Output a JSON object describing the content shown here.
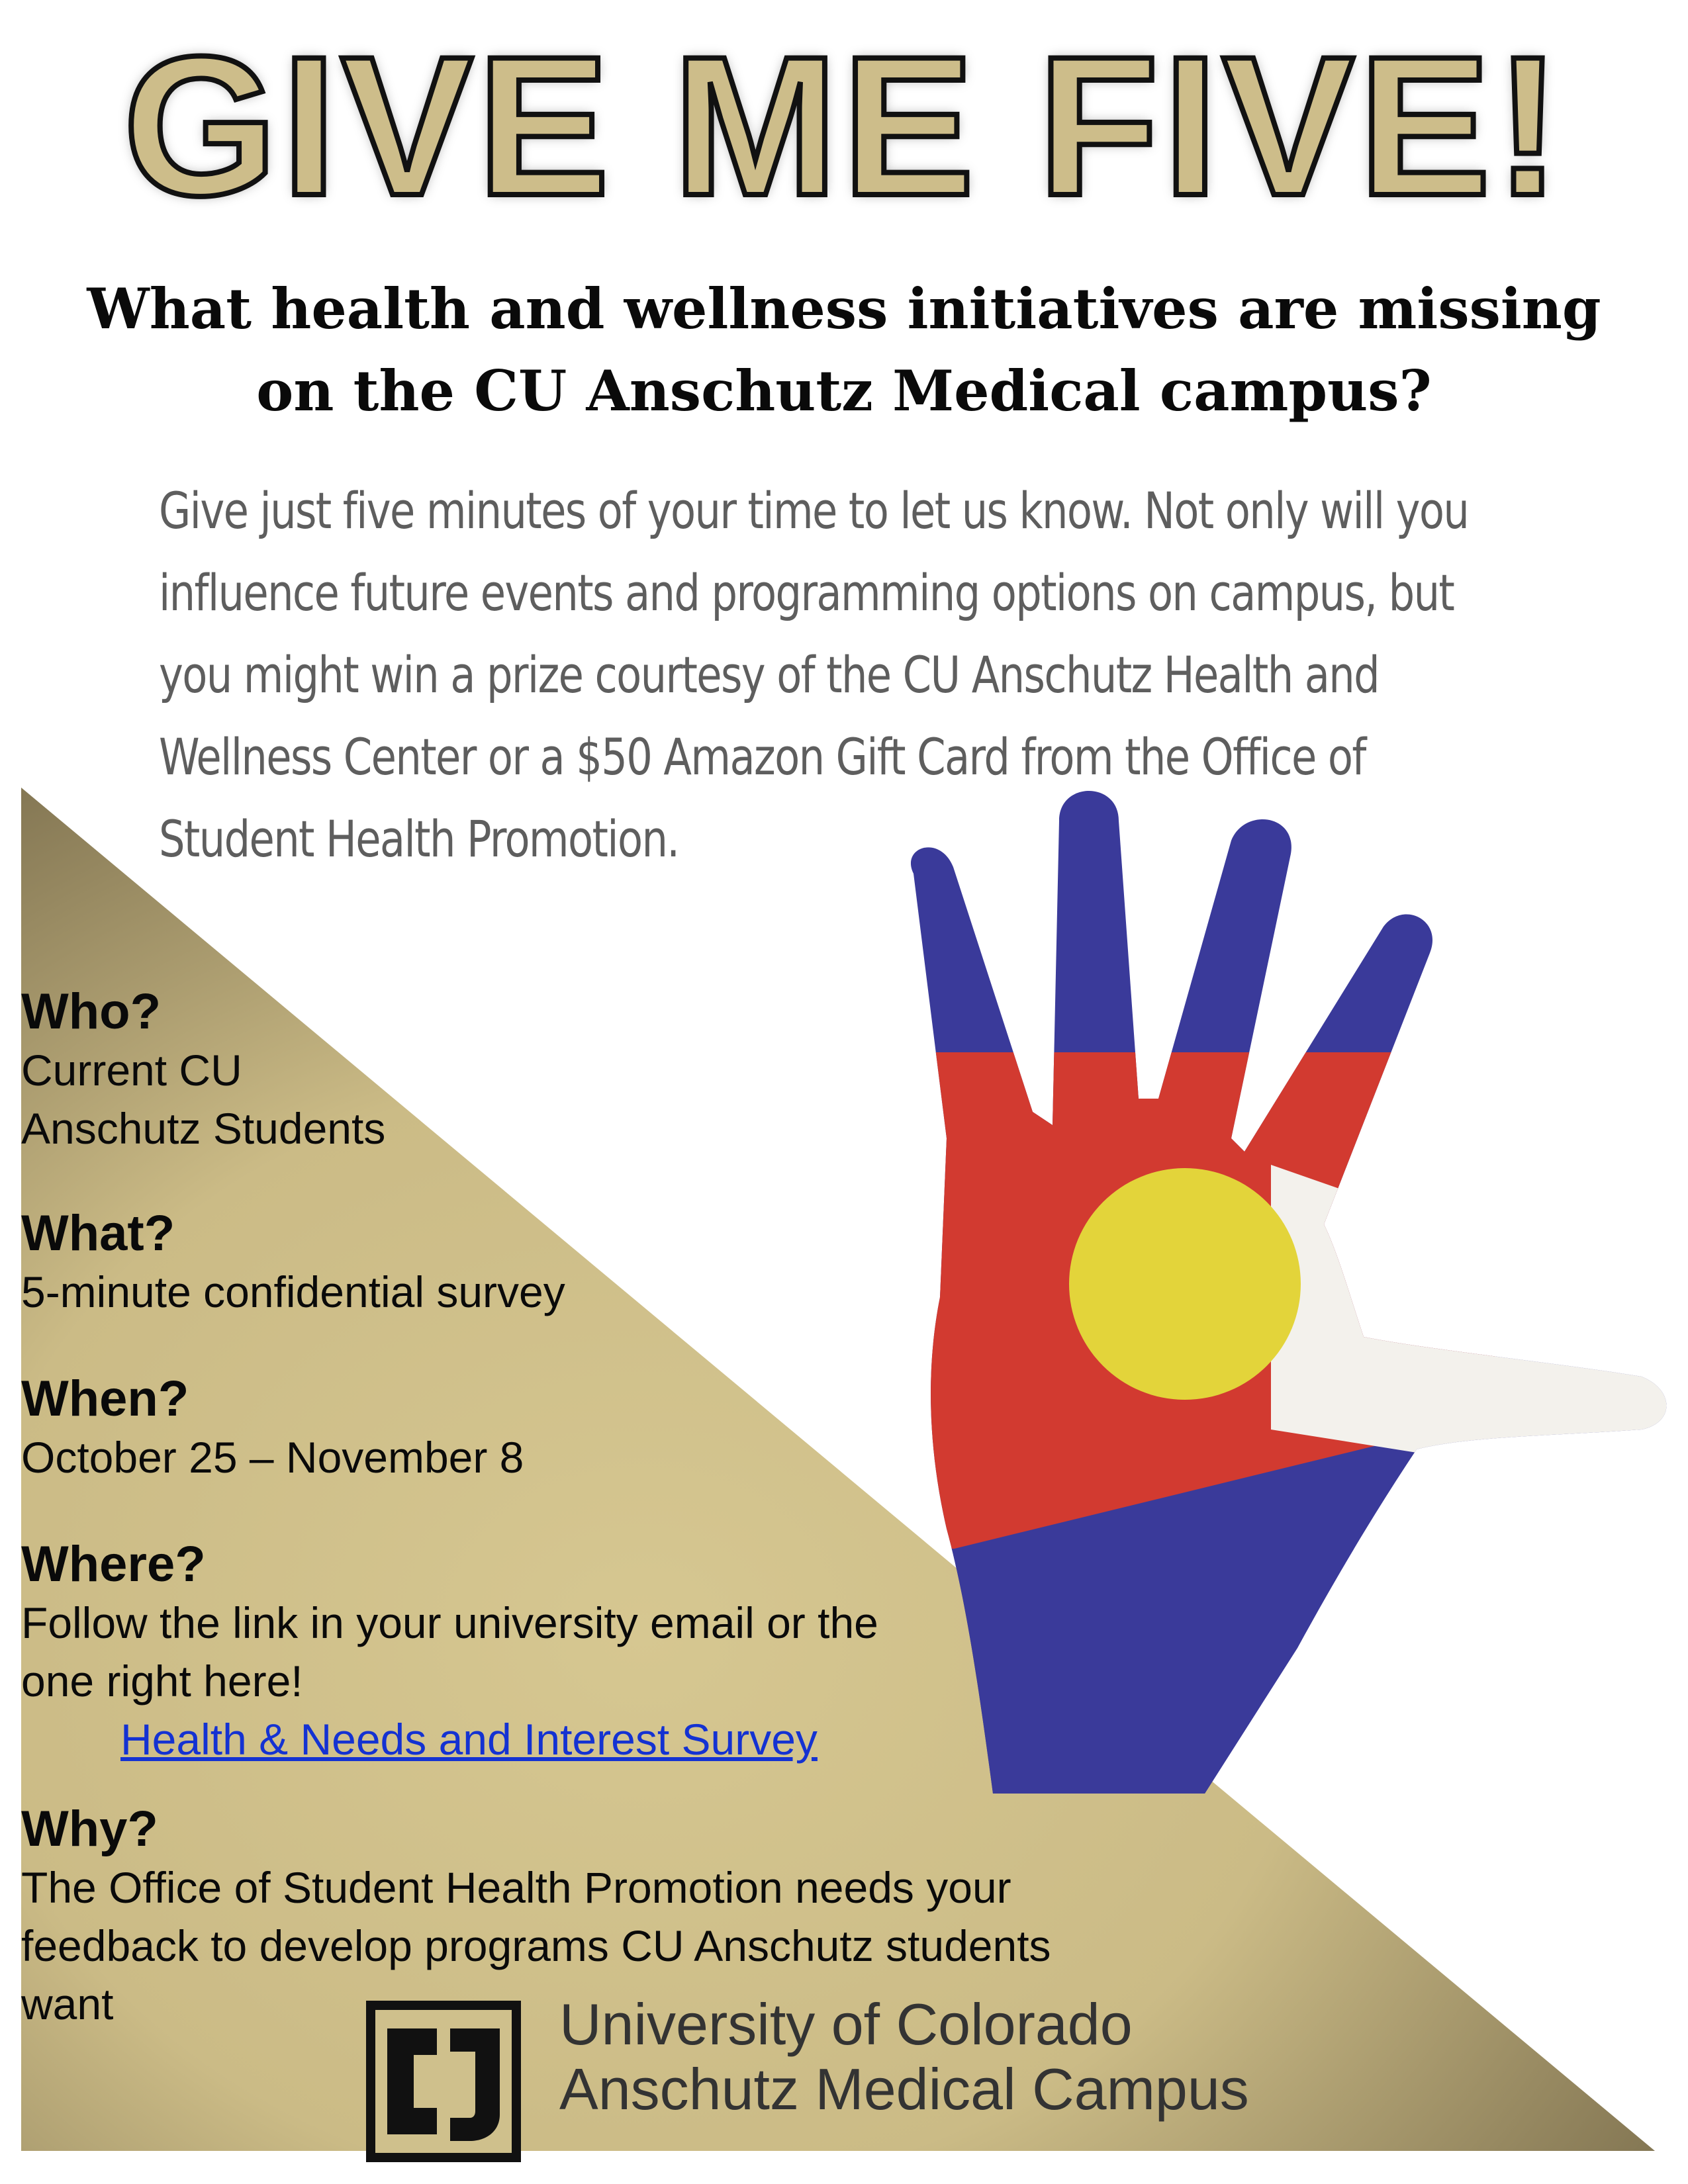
{
  "colors": {
    "gold": "#cfc08c",
    "gold_dark": "#8a7c55",
    "flag_blue": "#3a3a9a",
    "flag_red": "#d23a30",
    "flag_yellow": "#e3d43a",
    "link": "#1432d2"
  },
  "header": {
    "title": "GIVE ME FIVE!",
    "question_line1": "What health and wellness initiatives are missing",
    "question_line2": "on the CU Anschutz Medical campus?"
  },
  "intro": {
    "lines": [
      "Give just five minutes of your time to let us know. Not only will you",
      "influence future events and programming options on campus, but",
      "you might win a prize courtesy of the CU Anschutz Health and",
      "Wellness Center or a $50 Amazon Gift Card from the Office of",
      "Student Health Promotion."
    ]
  },
  "hand_image": {
    "icon": "colorado-flag-painted-hand-icon"
  },
  "who": {
    "heading": "Who?",
    "line1": "Current CU",
    "line2": "Anschutz Students"
  },
  "what": {
    "heading": "What?",
    "text": "5-minute confidential survey"
  },
  "when": {
    "heading": "When?",
    "text": "October 25 – November 8"
  },
  "where": {
    "heading": "Where?",
    "line1": "Follow the link in your university email or the",
    "line2": "one right here!",
    "link_label": "Health & Needs and Interest Survey"
  },
  "why": {
    "heading": "Why?",
    "line1": "The Office of Student Health Promotion needs your",
    "line2": "feedback to develop programs CU Anschutz students want"
  },
  "footer": {
    "logo_icon": "cu-logo-icon",
    "line1": "University of Colorado",
    "line2": "Anschutz Medical Campus"
  }
}
